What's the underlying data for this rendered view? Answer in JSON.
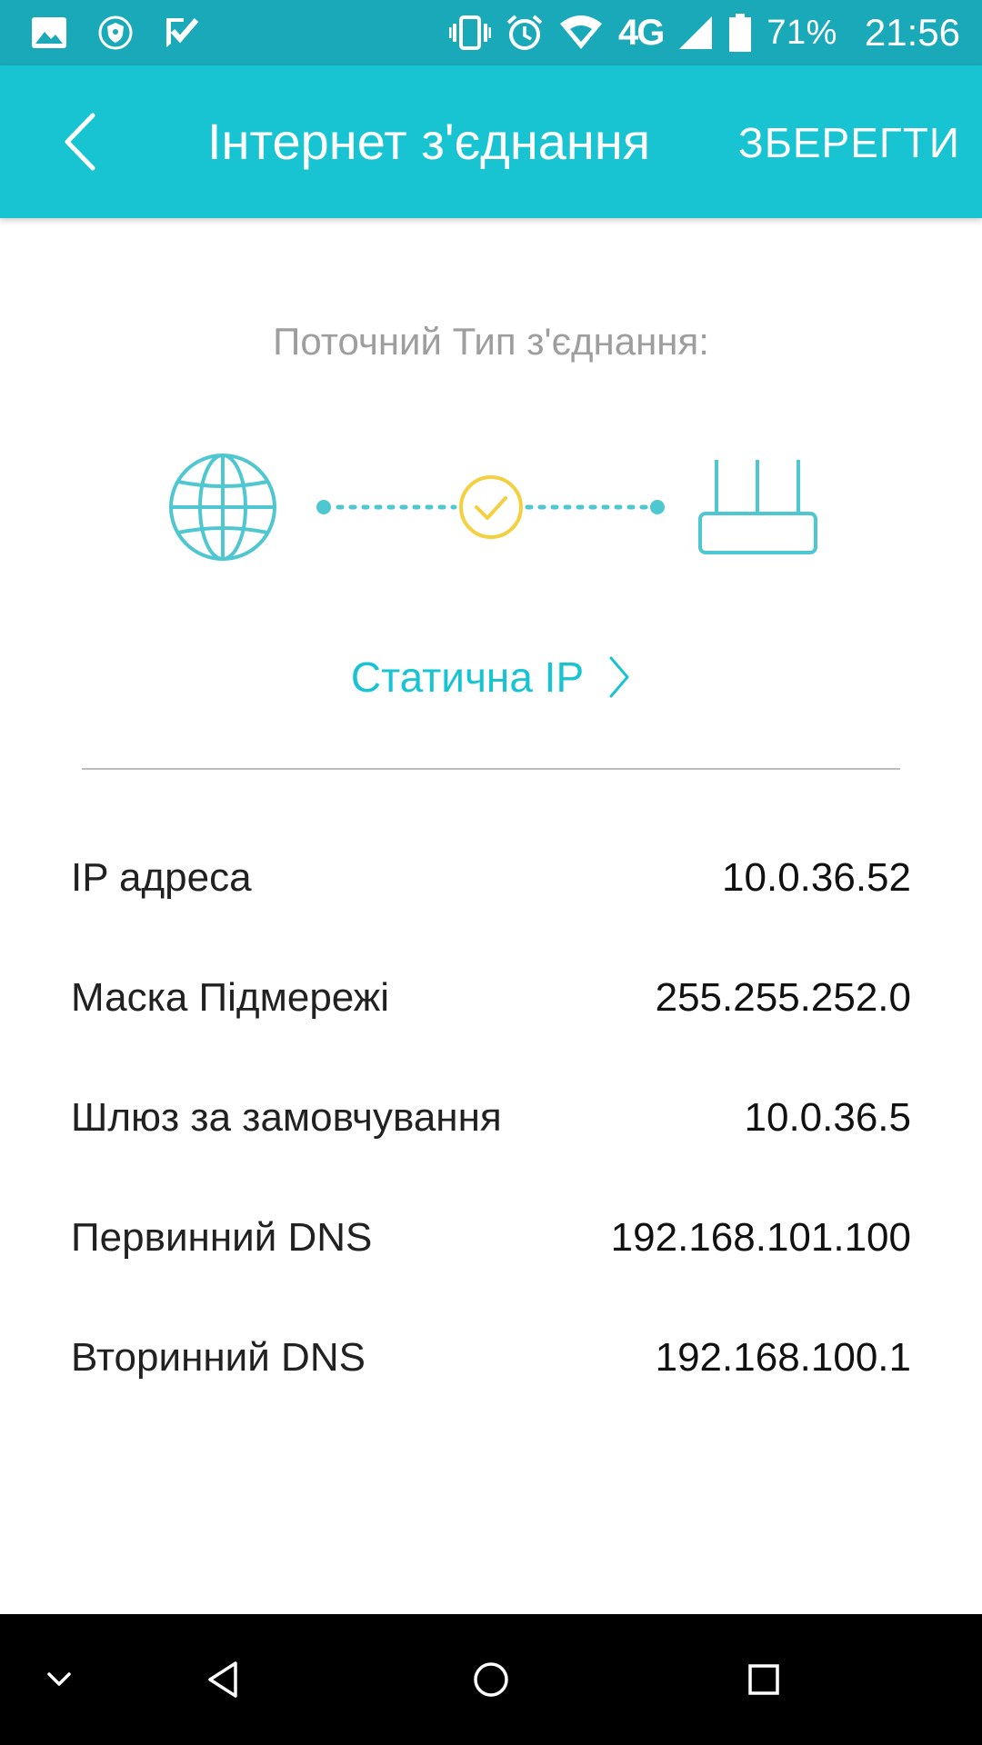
{
  "status_bar": {
    "battery_percent": "71%",
    "time": "21:56",
    "network_type": "4G",
    "icons": [
      "image-icon",
      "shield-icon",
      "check-icon",
      "vibrate-icon",
      "alarm-icon",
      "wifi-icon",
      "signal-icon",
      "battery-icon"
    ]
  },
  "app_bar": {
    "title": "Інтернет з'єднання",
    "save_label": "ЗБЕРЕГТИ"
  },
  "connection": {
    "current_type_label": "Поточний Тип з'єднання:",
    "type_value": "Статична IP",
    "colors": {
      "accent": "#19c4d2",
      "status": "#f4d03f"
    }
  },
  "settings": {
    "rows": [
      {
        "label": "IP адреса",
        "value": "10.0.36.52"
      },
      {
        "label": "Маска Підмережі",
        "value": "255.255.252.0"
      },
      {
        "label": "Шлюз за замовчування",
        "value": "10.0.36.5"
      },
      {
        "label": "Первинний DNS",
        "value": "192.168.101.100"
      },
      {
        "label": "Вторинний DNS",
        "value": "192.168.100.1"
      }
    ]
  },
  "nav_bar": {
    "icons": [
      "collapse-icon",
      "back-icon",
      "home-icon",
      "recents-icon"
    ]
  }
}
